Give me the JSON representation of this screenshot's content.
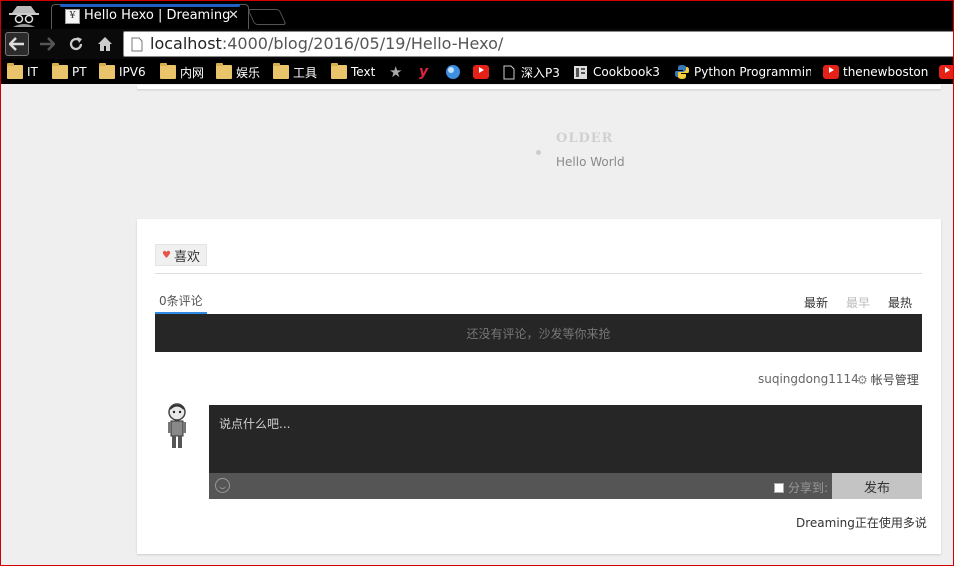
{
  "browser": {
    "tab": {
      "title": "Hello Hexo | Dreaming",
      "favicon": "dreaming-favicon"
    },
    "url": {
      "host": "localhost",
      "path": ":4000/blog/2016/05/19/Hello-Hexo/"
    },
    "bookmarks": [
      {
        "label": "IT",
        "icon": "folder-icon"
      },
      {
        "label": "PT",
        "icon": "folder-icon"
      },
      {
        "label": "IPV6",
        "icon": "folder-icon"
      },
      {
        "label": "内网",
        "icon": "folder-icon"
      },
      {
        "label": "娱乐",
        "icon": "folder-icon"
      },
      {
        "label": "工具",
        "icon": "folder-icon"
      },
      {
        "label": "Text",
        "icon": "folder-icon"
      },
      {
        "label": "",
        "icon": "star-icon"
      },
      {
        "label": "",
        "icon": "y-icon"
      },
      {
        "label": "",
        "icon": "globe-icon"
      },
      {
        "label": "",
        "icon": "youtube-icon"
      },
      {
        "label": "深入P3",
        "icon": "page-icon"
      },
      {
        "label": "Cookbook3",
        "icon": "book-icon"
      },
      {
        "label": "Python Programmin",
        "icon": "python-icon"
      },
      {
        "label": "thenewboston",
        "icon": "youtube-icon"
      },
      {
        "label": "",
        "icon": "youtube-icon"
      }
    ]
  },
  "post_nav": {
    "older_label": "OLDER",
    "older_title": "Hello World"
  },
  "comments": {
    "like_label": "喜欢",
    "count_label": "0条评论",
    "sort": {
      "newest": "最新",
      "oldest": "最早",
      "hottest": "最热"
    },
    "empty_message": "还没有评论，沙发等你来抢",
    "username": "suqingdong1114",
    "account_label": "帐号管理",
    "placeholder": "说点什么吧...",
    "share_label": "分享到:",
    "publish_label": "发布",
    "powered_by": "Dreaming正在使用多说"
  },
  "colors": {
    "tab_accent": "#1f5fc6",
    "heart": "#e5534b",
    "active_tab_underline": "#2f8ae5",
    "frame_border": "#d40000"
  }
}
